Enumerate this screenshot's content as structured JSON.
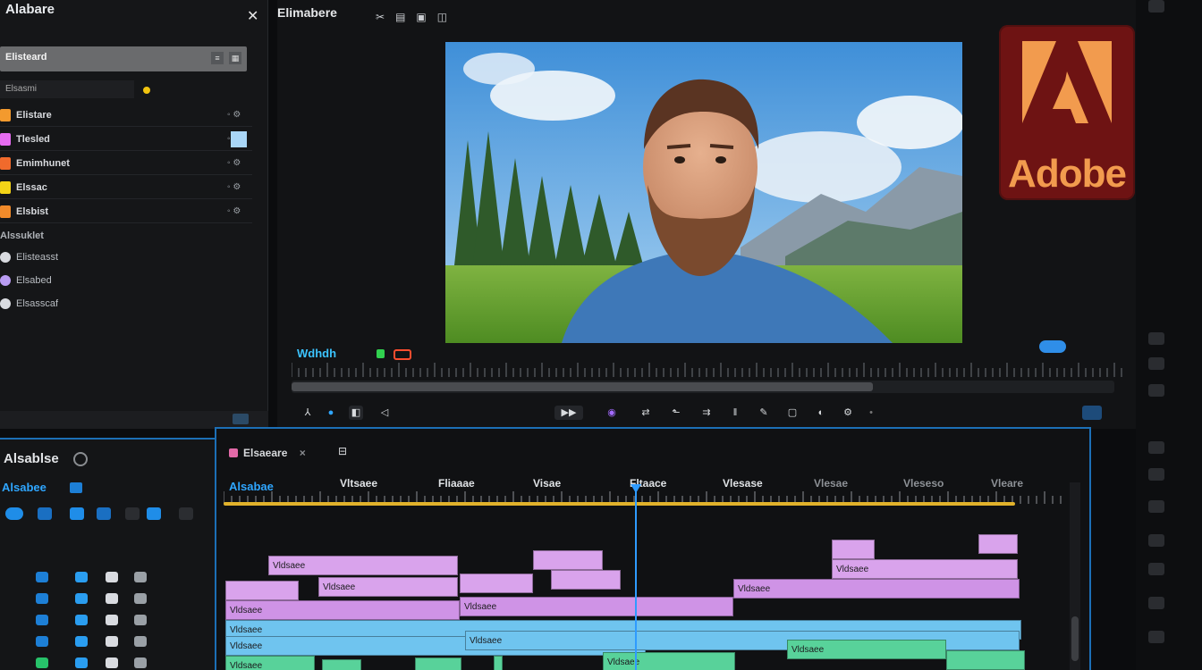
{
  "project_panel": {
    "title": "Alabare",
    "close_glyph": "✕",
    "search_text": "Elisteard",
    "filter_label": "Elsasmi",
    "bins": [
      {
        "label": "Elistare",
        "color": "#f39a2e"
      },
      {
        "label": "Tlesled",
        "color": "#e56bf0"
      },
      {
        "label": "Emimhunet",
        "color": "#f06a2c"
      },
      {
        "label": "Elssac",
        "color": "#f4d417"
      },
      {
        "label": "Elsbist",
        "color": "#f08a2a"
      }
    ],
    "section_label": "Alssuklet",
    "sub_items": [
      "Elisteasst",
      "Elsabed",
      "Elsasscaf"
    ]
  },
  "monitor": {
    "tab_title": "Elimabere",
    "timecode": "Wdhdh",
    "scene": "Bearded man in denim shirt standing in front of meadow, pine forest and mountains"
  },
  "brand": {
    "wordmark": "Adobe",
    "logo_bg": "#6e1313",
    "logo_fg": "#f29b4e"
  },
  "timeline": {
    "panel_title": "Alsablse",
    "sub_title": "Alsabee",
    "sequence_tab": "Elsaeare",
    "timecode": "Alsabae",
    "ruler_labels": [
      "Vltsaee",
      "Fliaaae",
      "Visae",
      "Fltaace",
      "Vlesase",
      "Vlesae",
      "Vleseso",
      "Vleare"
    ],
    "clip_label": "Vldsaee",
    "accent_color": "#1c6fb6",
    "work_area_color": "#e1b22b"
  }
}
